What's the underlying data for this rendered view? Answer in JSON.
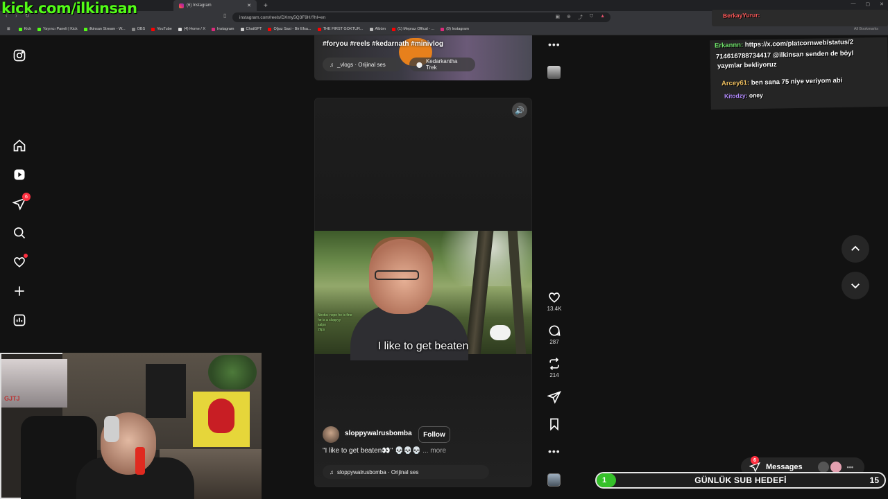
{
  "overlay": {
    "stream_url": "kick.com/ilkinsan"
  },
  "browser": {
    "active_tab": "(6) Instagram",
    "url": "instagram.com/reels/DXmy5Q3F9H/?hl=en",
    "bookmarks": [
      {
        "label": "Kick",
        "color": "#53fc18"
      },
      {
        "label": "Yayıncı Paneli | Kick",
        "color": "#53fc18"
      },
      {
        "label": "ilkinsan Stream - W...",
        "color": "#53fc18"
      },
      {
        "label": "OBS",
        "color": "#888888"
      },
      {
        "label": "YouTube",
        "color": "#ff0000"
      },
      {
        "label": "(4) Home / X",
        "color": "#dddddd"
      },
      {
        "label": "Instagram",
        "color": "#dd2a7b"
      },
      {
        "label": "ChatGPT",
        "color": "#cccccc"
      },
      {
        "label": "Oğuz Sasi - Bir Efsa...",
        "color": "#ff0000"
      },
      {
        "label": "THE FIRST GOKTUR...",
        "color": "#ff0000"
      },
      {
        "label": "Albüm",
        "color": "#bbbbbb"
      },
      {
        "label": "(1) Mepraz Offical - ...",
        "color": "#ff0000"
      },
      {
        "label": "(9) Instagram",
        "color": "#dd2a7b"
      }
    ],
    "all_bookmarks": "All Bookmarks"
  },
  "sidebar": {
    "notifications_badge": "6"
  },
  "prev_reel": {
    "tags": "#foryou #reels #kedarnath #minivlog",
    "audio": "_vlogs · Orijinal ses",
    "location": "Kedarkantha Trek"
  },
  "reel": {
    "video_caption": "I like to get beaten",
    "chat_overlay": [
      "Nextia: nope he is fine",
      "he is a sloppyy",
      "salpo",
      "2lips"
    ],
    "owner": "sloppywalrusbomba",
    "follow_label": "Follow",
    "caption": "\"I like to get beaten👀\" 💀💀💀",
    "more": "... more",
    "audio": "sloppywalrusbomba · Orijinal ses",
    "likes": "13.4K",
    "comments": "287",
    "reposts": "214"
  },
  "chat": {
    "lines": [
      {
        "user": "Erkannn:",
        "text": "https://x.com/platcornweb/status/2",
        "color": "#6fe06a"
      },
      {
        "user": "",
        "text": "714616788734417 @ilkinsan senden de böyl",
        "color": ""
      },
      {
        "user": "",
        "text": "yaymlar bekliyoruz",
        "color": ""
      },
      {
        "user": "Arcey61:",
        "text": "ben sana 75 niye veriyom abi",
        "color": "#f0c060"
      },
      {
        "user": "Kitodzy:",
        "text": "oney",
        "color": "#b48cff"
      }
    ],
    "top_user": "BerkayYurur:"
  },
  "messages": {
    "label": "Messages",
    "badge": "6"
  },
  "sub_goal": {
    "label": "GÜNLÜK SUB HEDEFİ",
    "current": "1",
    "target": "15",
    "progress": 0.067,
    "color": "#35c12a"
  },
  "webcam": {
    "poster_text": "GJTJ"
  }
}
